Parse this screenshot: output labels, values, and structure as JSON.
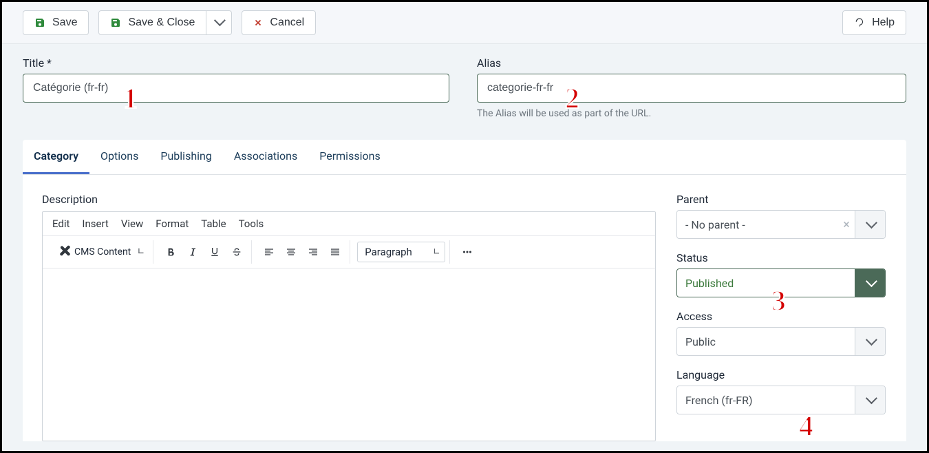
{
  "toolbar": {
    "save": "Save",
    "save_close": "Save & Close",
    "cancel": "Cancel",
    "help": "Help"
  },
  "fields": {
    "title_label": "Title *",
    "title_value": "Catégorie (fr-fr)",
    "alias_label": "Alias",
    "alias_value": "categorie-fr-fr",
    "alias_help": "The Alias will be used as part of the URL."
  },
  "tabs": [
    "Category",
    "Options",
    "Publishing",
    "Associations",
    "Permissions"
  ],
  "active_tab": 0,
  "editor": {
    "description_label": "Description",
    "menus": [
      "Edit",
      "Insert",
      "View",
      "Format",
      "Table",
      "Tools"
    ],
    "cms_button": "CMS Content",
    "block_format": "Paragraph"
  },
  "sidebar": {
    "parent": {
      "label": "Parent",
      "value": "- No parent -"
    },
    "status": {
      "label": "Status",
      "value": "Published"
    },
    "access": {
      "label": "Access",
      "value": "Public"
    },
    "language": {
      "label": "Language",
      "value": "French (fr-FR)"
    }
  },
  "annotations": [
    "1",
    "2",
    "3",
    "4"
  ]
}
